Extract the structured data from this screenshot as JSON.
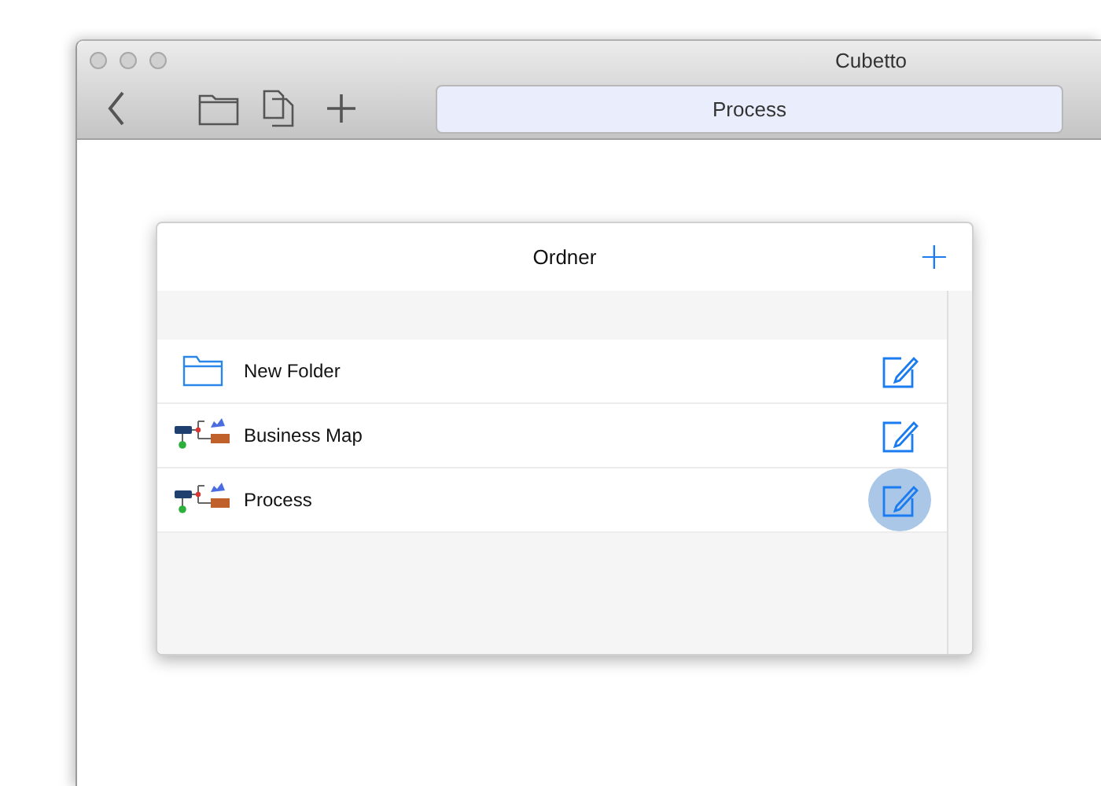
{
  "window": {
    "title": "Cubetto"
  },
  "toolbar": {
    "path": "Process"
  },
  "panel": {
    "title": "Ordner",
    "add": "+"
  },
  "items": [
    {
      "kind": "folder",
      "label": "New Folder",
      "highlighted": false
    },
    {
      "kind": "map",
      "label": "Business Map",
      "highlighted": false
    },
    {
      "kind": "map",
      "label": "Process",
      "highlighted": true
    }
  ]
}
